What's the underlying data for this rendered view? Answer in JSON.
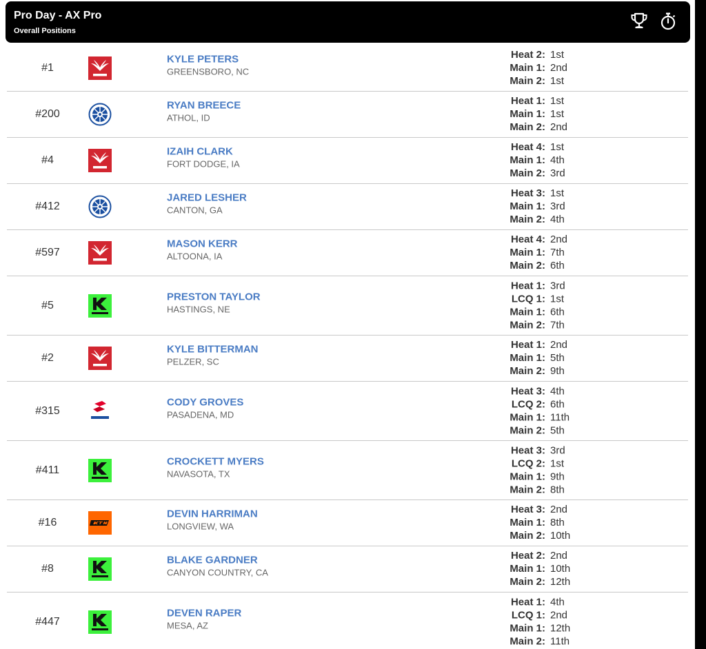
{
  "header": {
    "title": "Pro Day - AX Pro",
    "subtitle": "Overall Positions",
    "icons": [
      "trophy-icon",
      "stopwatch-icon"
    ]
  },
  "colors": {
    "header_bg": "#000000",
    "rider_name": "#4a7cc4",
    "honda": "#d22630",
    "yamaha": "#1a4fa0",
    "kawasaki": "#3cf03c",
    "ktm": "#ff6600",
    "suzuki": "#e4002b"
  },
  "rows": [
    {
      "pos": "#1",
      "brand": "honda",
      "name": "KYLE PETERS",
      "home": "GREENSBORO, NC",
      "results": [
        {
          "label": "Heat 2:",
          "value": "1st"
        },
        {
          "label": "Main 1:",
          "value": "2nd"
        },
        {
          "label": "Main 2:",
          "value": "1st"
        }
      ]
    },
    {
      "pos": "#200",
      "brand": "yamaha",
      "name": "RYAN BREECE",
      "home": "ATHOL, ID",
      "results": [
        {
          "label": "Heat 1:",
          "value": "1st"
        },
        {
          "label": "Main 1:",
          "value": "1st"
        },
        {
          "label": "Main 2:",
          "value": "2nd"
        }
      ]
    },
    {
      "pos": "#4",
      "brand": "honda",
      "name": "IZAIH CLARK",
      "home": "FORT DODGE, IA",
      "results": [
        {
          "label": "Heat 4:",
          "value": "1st"
        },
        {
          "label": "Main 1:",
          "value": "4th"
        },
        {
          "label": "Main 2:",
          "value": "3rd"
        }
      ]
    },
    {
      "pos": "#412",
      "brand": "yamaha",
      "name": "JARED LESHER",
      "home": "CANTON, GA",
      "results": [
        {
          "label": "Heat 3:",
          "value": "1st"
        },
        {
          "label": "Main 1:",
          "value": "3rd"
        },
        {
          "label": "Main 2:",
          "value": "4th"
        }
      ]
    },
    {
      "pos": "#597",
      "brand": "honda",
      "name": "MASON KERR",
      "home": "ALTOONA, IA",
      "results": [
        {
          "label": "Heat 4:",
          "value": "2nd"
        },
        {
          "label": "Main 1:",
          "value": "7th"
        },
        {
          "label": "Main 2:",
          "value": "6th"
        }
      ]
    },
    {
      "pos": "#5",
      "brand": "kawasaki",
      "name": "PRESTON TAYLOR",
      "home": "HASTINGS, NE",
      "results": [
        {
          "label": "Heat 1:",
          "value": "3rd"
        },
        {
          "label": "LCQ 1:",
          "value": "1st"
        },
        {
          "label": "Main 1:",
          "value": "6th"
        },
        {
          "label": "Main 2:",
          "value": "7th"
        }
      ]
    },
    {
      "pos": "#2",
      "brand": "honda",
      "name": "KYLE BITTERMAN",
      "home": "PELZER, SC",
      "results": [
        {
          "label": "Heat 1:",
          "value": "2nd"
        },
        {
          "label": "Main 1:",
          "value": "5th"
        },
        {
          "label": "Main 2:",
          "value": "9th"
        }
      ]
    },
    {
      "pos": "#315",
      "brand": "suzuki",
      "name": "CODY GROVES",
      "home": "PASADENA, MD",
      "results": [
        {
          "label": "Heat 3:",
          "value": "4th"
        },
        {
          "label": "LCQ 2:",
          "value": "6th"
        },
        {
          "label": "Main 1:",
          "value": "11th"
        },
        {
          "label": "Main 2:",
          "value": "5th"
        }
      ]
    },
    {
      "pos": "#411",
      "brand": "kawasaki",
      "name": "CROCKETT MYERS",
      "home": "NAVASOTA, TX",
      "results": [
        {
          "label": "Heat 3:",
          "value": "3rd"
        },
        {
          "label": "LCQ 2:",
          "value": "1st"
        },
        {
          "label": "Main 1:",
          "value": "9th"
        },
        {
          "label": "Main 2:",
          "value": "8th"
        }
      ]
    },
    {
      "pos": "#16",
      "brand": "ktm",
      "name": "DEVIN HARRIMAN",
      "home": "LONGVIEW, WA",
      "results": [
        {
          "label": "Heat 3:",
          "value": "2nd"
        },
        {
          "label": "Main 1:",
          "value": "8th"
        },
        {
          "label": "Main 2:",
          "value": "10th"
        }
      ]
    },
    {
      "pos": "#8",
      "brand": "kawasaki",
      "name": "BLAKE GARDNER",
      "home": "CANYON COUNTRY, CA",
      "results": [
        {
          "label": "Heat 2:",
          "value": "2nd"
        },
        {
          "label": "Main 1:",
          "value": "10th"
        },
        {
          "label": "Main 2:",
          "value": "12th"
        }
      ]
    },
    {
      "pos": "#447",
      "brand": "kawasaki",
      "name": "DEVEN RAPER",
      "home": "MESA, AZ",
      "results": [
        {
          "label": "Heat 1:",
          "value": "4th"
        },
        {
          "label": "LCQ 1:",
          "value": "2nd"
        },
        {
          "label": "Main 1:",
          "value": "12th"
        },
        {
          "label": "Main 2:",
          "value": "11th"
        }
      ]
    }
  ]
}
